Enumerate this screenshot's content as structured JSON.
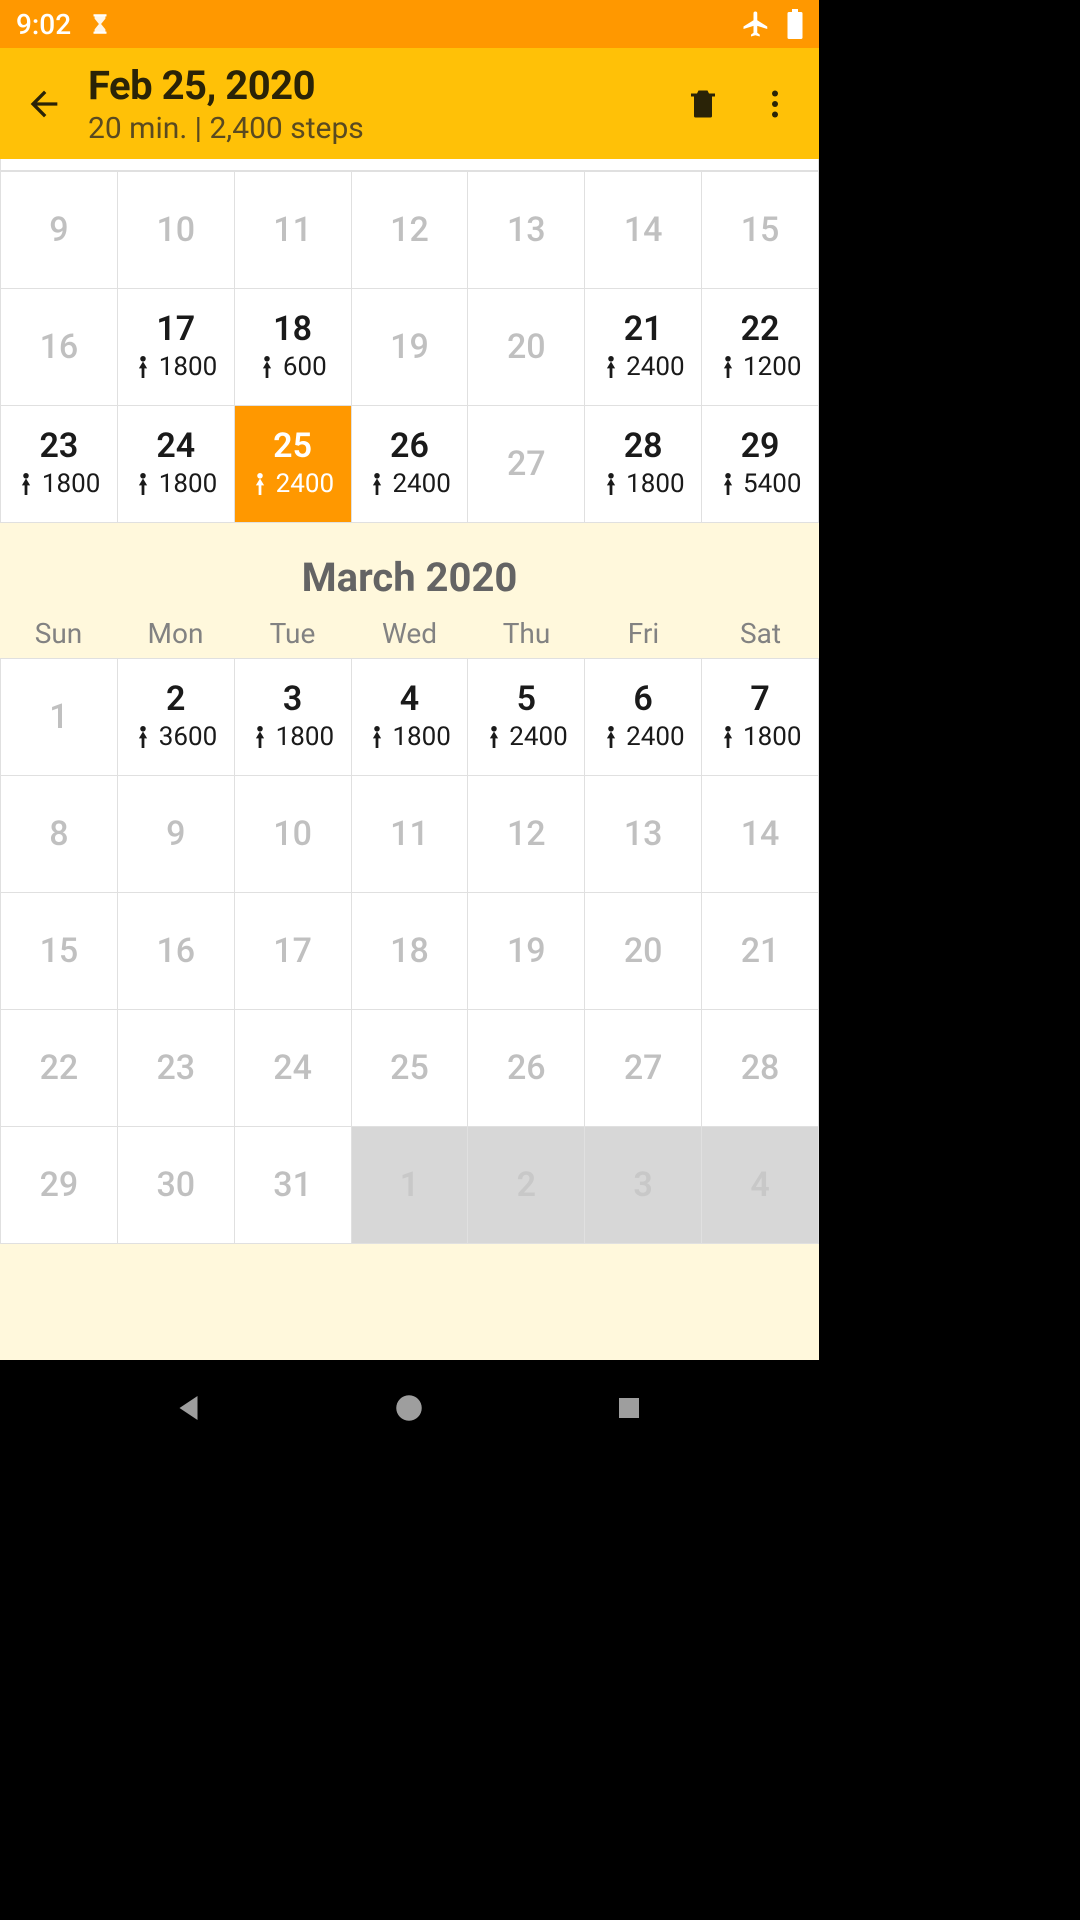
{
  "status": {
    "time": "9:02"
  },
  "appbar": {
    "title": "Feb 25, 2020",
    "subtitle": "20 min. | 2,400 steps"
  },
  "feb_rows": [
    [
      {
        "d": "9",
        "dim": true
      },
      {
        "d": "10",
        "dim": true
      },
      {
        "d": "11",
        "dim": true
      },
      {
        "d": "12",
        "dim": true
      },
      {
        "d": "13",
        "dim": true
      },
      {
        "d": "14",
        "dim": true
      },
      {
        "d": "15",
        "dim": true
      }
    ],
    [
      {
        "d": "16",
        "dim": true
      },
      {
        "d": "17",
        "s": "1800"
      },
      {
        "d": "18",
        "s": "600"
      },
      {
        "d": "19",
        "dim": true
      },
      {
        "d": "20",
        "dim": true
      },
      {
        "d": "21",
        "s": "2400"
      },
      {
        "d": "22",
        "s": "1200"
      }
    ],
    [
      {
        "d": "23",
        "s": "1800"
      },
      {
        "d": "24",
        "s": "1800"
      },
      {
        "d": "25",
        "s": "2400",
        "sel": true
      },
      {
        "d": "26",
        "s": "2400"
      },
      {
        "d": "27",
        "dim": true
      },
      {
        "d": "28",
        "s": "1800"
      },
      {
        "d": "29",
        "s": "5400"
      }
    ]
  ],
  "march": {
    "title": "March 2020",
    "wdays": [
      "Sun",
      "Mon",
      "Tue",
      "Wed",
      "Thu",
      "Fri",
      "Sat"
    ],
    "rows": [
      [
        {
          "d": "1",
          "dim": true
        },
        {
          "d": "2",
          "s": "3600"
        },
        {
          "d": "3",
          "s": "1800"
        },
        {
          "d": "4",
          "s": "1800"
        },
        {
          "d": "5",
          "s": "2400"
        },
        {
          "d": "6",
          "s": "2400"
        },
        {
          "d": "7",
          "s": "1800"
        }
      ],
      [
        {
          "d": "8",
          "dim": true
        },
        {
          "d": "9",
          "dim": true
        },
        {
          "d": "10",
          "dim": true
        },
        {
          "d": "11",
          "dim": true
        },
        {
          "d": "12",
          "dim": true
        },
        {
          "d": "13",
          "dim": true
        },
        {
          "d": "14",
          "dim": true
        }
      ],
      [
        {
          "d": "15",
          "dim": true
        },
        {
          "d": "16",
          "dim": true
        },
        {
          "d": "17",
          "dim": true
        },
        {
          "d": "18",
          "dim": true
        },
        {
          "d": "19",
          "dim": true
        },
        {
          "d": "20",
          "dim": true
        },
        {
          "d": "21",
          "dim": true
        }
      ],
      [
        {
          "d": "22",
          "dim": true
        },
        {
          "d": "23",
          "dim": true
        },
        {
          "d": "24",
          "dim": true
        },
        {
          "d": "25",
          "dim": true
        },
        {
          "d": "26",
          "dim": true
        },
        {
          "d": "27",
          "dim": true
        },
        {
          "d": "28",
          "dim": true
        }
      ],
      [
        {
          "d": "29",
          "dim": true
        },
        {
          "d": "30",
          "dim": true
        },
        {
          "d": "31",
          "dim": true
        },
        {
          "d": "1",
          "next": true
        },
        {
          "d": "2",
          "next": true
        },
        {
          "d": "3",
          "next": true
        },
        {
          "d": "4",
          "next": true
        }
      ]
    ]
  }
}
